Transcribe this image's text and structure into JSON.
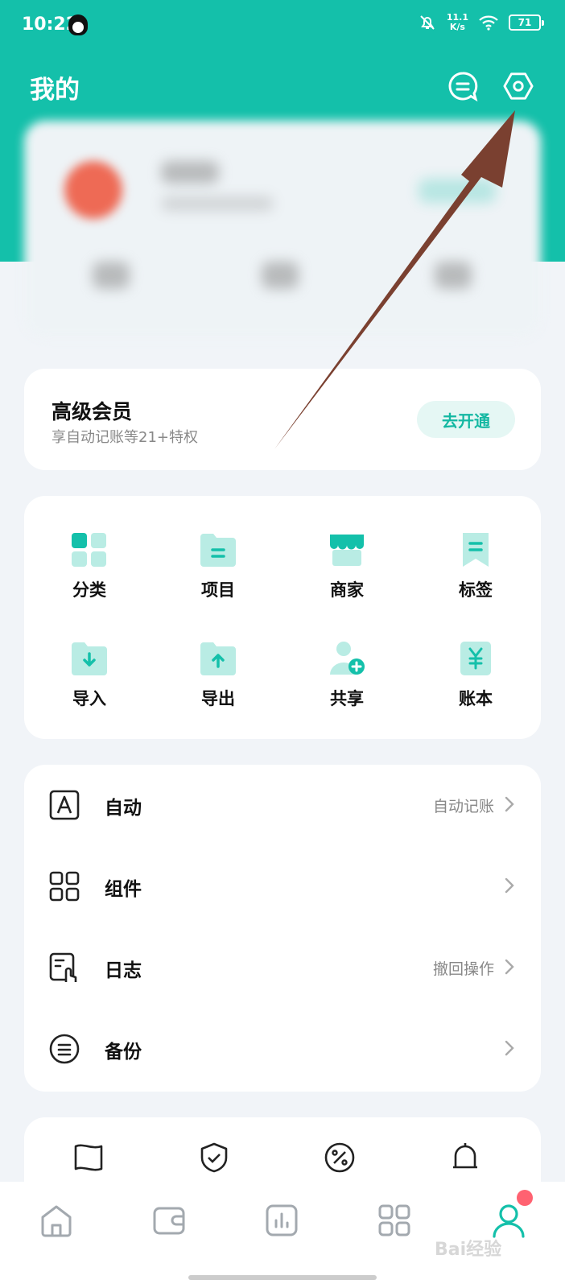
{
  "status_bar": {
    "time": "10:22",
    "net_speed": "11.1",
    "net_unit": "K/s",
    "battery": "71"
  },
  "header": {
    "title": "我的",
    "message_icon": "message-icon",
    "settings_icon": "settings-hexagon-icon"
  },
  "vip": {
    "title": "高级会员",
    "subtitle": "享自动记账等21+特权",
    "button": "去开通"
  },
  "grid": {
    "items": [
      {
        "label": "分类",
        "icon": "category-icon"
      },
      {
        "label": "项目",
        "icon": "folder-icon"
      },
      {
        "label": "商家",
        "icon": "store-icon"
      },
      {
        "label": "标签",
        "icon": "tag-icon"
      },
      {
        "label": "导入",
        "icon": "import-icon"
      },
      {
        "label": "导出",
        "icon": "export-icon"
      },
      {
        "label": "共享",
        "icon": "share-user-icon"
      },
      {
        "label": "账本",
        "icon": "ledger-icon"
      }
    ]
  },
  "list": {
    "items": [
      {
        "label": "自动",
        "right": "自动记账",
        "icon": "auto-a-icon"
      },
      {
        "label": "组件",
        "right": "",
        "icon": "widgets-icon"
      },
      {
        "label": "日志",
        "right": "撤回操作",
        "icon": "log-icon"
      },
      {
        "label": "备份",
        "right": "",
        "icon": "backup-icon"
      }
    ]
  },
  "tabbar": {
    "items": [
      "home-icon",
      "wallet-icon",
      "stats-icon",
      "apps-icon",
      "profile-icon"
    ]
  },
  "watermark": "Bai经验",
  "colors": {
    "accent": "#14c0aa",
    "badge": "#ff6271",
    "arrow": "#7a4030"
  }
}
